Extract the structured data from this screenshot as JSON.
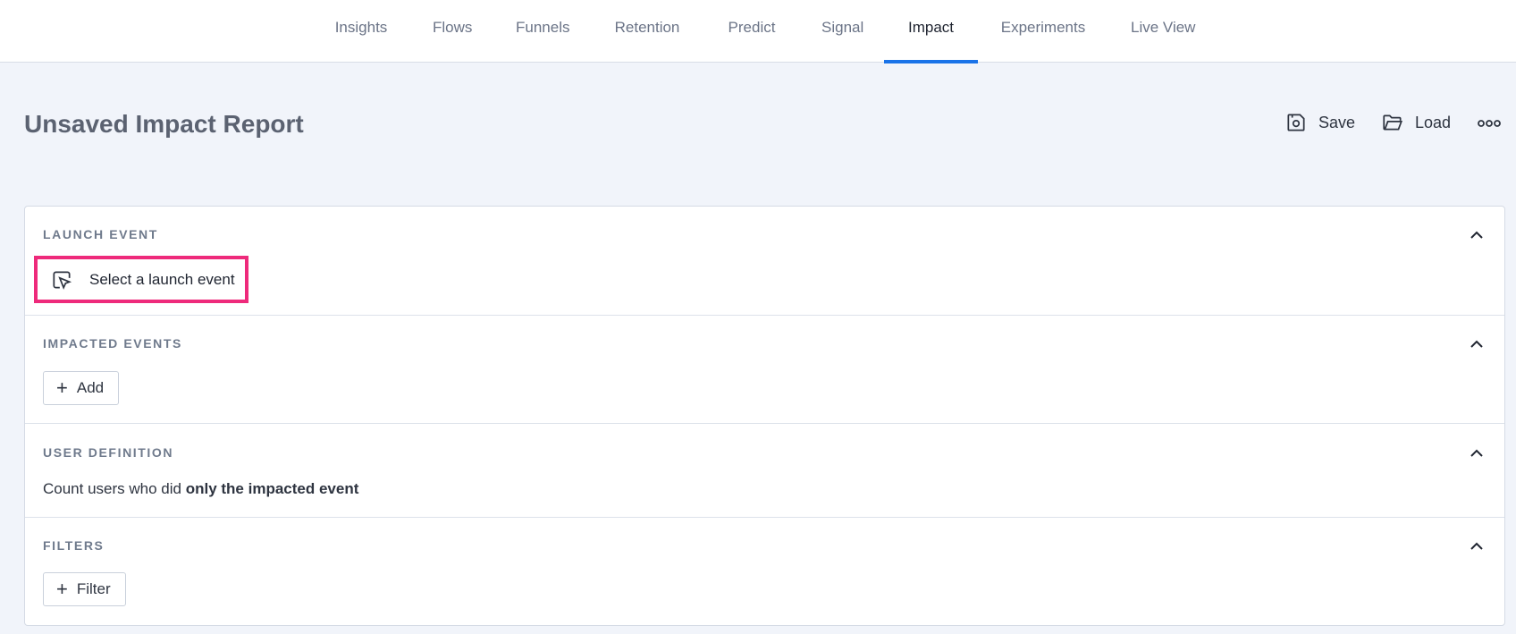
{
  "nav": {
    "tabs": [
      {
        "label": "Insights"
      },
      {
        "label": "Flows"
      },
      {
        "label": "Funnels"
      },
      {
        "label": "Retention"
      },
      {
        "label": "Predict"
      },
      {
        "label": "Signal"
      },
      {
        "label": "Impact",
        "active": true
      },
      {
        "label": "Experiments"
      },
      {
        "label": "Live View"
      }
    ]
  },
  "page": {
    "title": "Unsaved Impact Report",
    "actions": {
      "save_label": "Save",
      "load_label": "Load",
      "more_icon": "more-horizontal-icon"
    }
  },
  "sections": {
    "launch": {
      "title": "LAUNCH EVENT",
      "button_label": "Select a launch event",
      "icon": "cursor-select-icon"
    },
    "impacted": {
      "title": "IMPACTED EVENTS",
      "add_label": "Add"
    },
    "user_def": {
      "title": "USER DEFINITION",
      "text_prefix": "Count users who did",
      "text_bold": "only the impacted event"
    },
    "filters": {
      "title": "FILTERS",
      "filter_label": "Filter"
    }
  },
  "colors": {
    "accent": "#1a73e8",
    "highlight": "#ee2a7b",
    "background": "#f1f4fa"
  }
}
